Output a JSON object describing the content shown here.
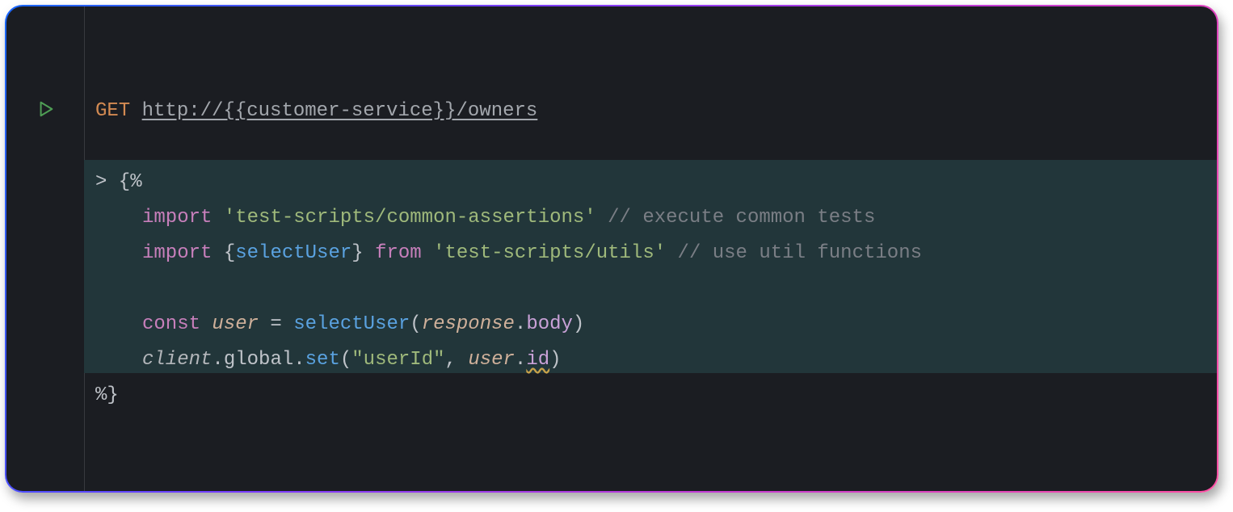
{
  "request": {
    "method": "GET",
    "url": "http://{{customer-service}}/owners"
  },
  "script": {
    "open": "> {%",
    "line_import1": {
      "kw": "import",
      "str": "'test-scripts/common-assertions'",
      "comment": "// execute common tests"
    },
    "line_import2": {
      "kw": "import",
      "lbrace": "{",
      "name": "selectUser",
      "rbrace": "}",
      "from": "from",
      "str": "'test-scripts/utils'",
      "comment": "// use util functions"
    },
    "line_const": {
      "kw": "const",
      "var": "user",
      "eq": " = ",
      "fn": "selectUser",
      "lp": "(",
      "arg": "response",
      "dot": ".",
      "prop": "body",
      "rp": ")"
    },
    "line_set": {
      "obj": "client",
      "d1": ".",
      "p1": "global",
      "d2": ".",
      "fn": "set",
      "lp": "(",
      "s": "\"userId\"",
      "comma": ", ",
      "arg": "user",
      "d3": ".",
      "prop": "id",
      "rp": ")"
    },
    "close": "%}"
  },
  "icons": {
    "run": "run-icon"
  }
}
